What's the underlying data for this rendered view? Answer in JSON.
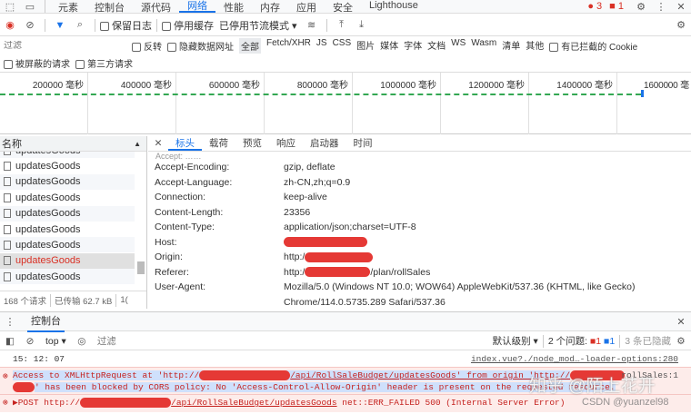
{
  "tabs": [
    "元素",
    "控制台",
    "源代码",
    "网络",
    "性能",
    "内存",
    "应用",
    "安全",
    "Lighthouse"
  ],
  "active_tab": 3,
  "badges": {
    "errors": "3",
    "issues": "1"
  },
  "toolbar": {
    "preserve_log": "保留日志",
    "disable_cache": "停用缓存",
    "throttle": "已停用节流模式"
  },
  "filter": {
    "placeholder": "过滤",
    "invert": "反转",
    "hide_data_urls": "隐藏数据网址",
    "types": [
      "全部",
      "Fetch/XHR",
      "JS",
      "CSS",
      "图片",
      "媒体",
      "字体",
      "文档",
      "WS",
      "Wasm",
      "清单",
      "其他"
    ],
    "blocked_cookies": "有已拦截的 Cookie",
    "blocked_requests": "被屏蔽的请求",
    "third_party": "第三方请求"
  },
  "timeline": [
    "200000 毫秒",
    "400000 毫秒",
    "600000 毫秒",
    "800000 毫秒",
    "1000000 毫秒",
    "1200000 毫秒",
    "1400000 毫秒",
    "1600000 毫"
  ],
  "list": {
    "header": "名称",
    "items": [
      "updatesGoods",
      "updatesGoods",
      "updatesGoods",
      "updatesGoods",
      "updatesGoods",
      "updatesGoods",
      "updatesGoods",
      "updatesGoods",
      "updatesGoods"
    ],
    "selected": 7,
    "footer_requests": "168 个请求",
    "footer_transferred": "已传输 62.7 kB",
    "footer_more": "1("
  },
  "detail": {
    "tabs": [
      "标头",
      "载荷",
      "预览",
      "响应",
      "启动器",
      "时间"
    ],
    "headers": [
      {
        "k": "Accept-Encoding:",
        "v": "gzip, deflate"
      },
      {
        "k": "Accept-Language:",
        "v": "zh-CN,zh;q=0.9"
      },
      {
        "k": "Connection:",
        "v": "keep-alive"
      },
      {
        "k": "Content-Length:",
        "v": "23356"
      },
      {
        "k": "Content-Type:",
        "v": "application/json;charset=UTF-8"
      },
      {
        "k": "Host:",
        "v": ""
      },
      {
        "k": "Origin:",
        "v": "http:/"
      },
      {
        "k": "Referer:",
        "v": "http:/"
      },
      {
        "k": "User-Agent:",
        "v": "Mozilla/5.0 (Windows NT 10.0; WOW64) AppleWebKit/537.36 (KHTML, like Gecko)"
      }
    ],
    "referer_suffix": "/plan/rollSales",
    "ua_line2": "Chrome/114.0.5735.289 Safari/537.36"
  },
  "console": {
    "tab": "控制台",
    "context": "top",
    "filter_placeholder": "过滤",
    "level": "默认级别",
    "issues": "2 个问题:",
    "issue_err": "1",
    "issue_info": "1",
    "hidden": "3 条已隐藏",
    "time": "15: 12: 07",
    "source": "index.vue?./node_mod…-loader-options:280",
    "err1_a": "Access to XMLHttpRequest at 'http://",
    "err1_b": "/api/RollSaleBudget/updatesGoods' from origin 'http://",
    "err1_src": "rollSales:1",
    "err1_c": "' has been blocked by CORS policy: No 'Access-Control-Allow-Origin' header is present on the requested resource.",
    "err2_a": "▶POST http://",
    "err2_b": "/api/RollSaleBudget/updatesGoods",
    "err2_c": " net::ERR_FAILED 500 (Internal Server Error)"
  },
  "watermark": {
    "zhihu": "知乎 @陌上花开",
    "csdn": "CSDN @yuanzel98"
  }
}
